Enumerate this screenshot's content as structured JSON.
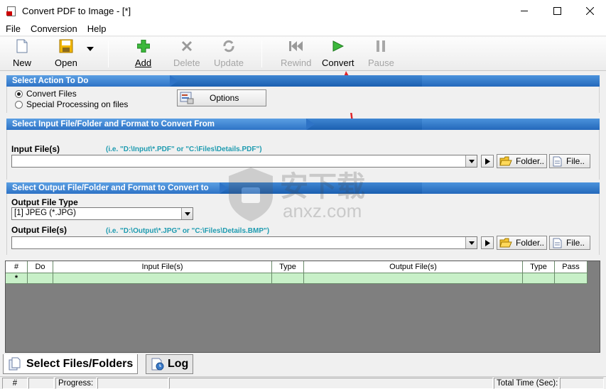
{
  "window": {
    "title": "Convert PDF to Image - [*]"
  },
  "menu": [
    "File",
    "Conversion",
    "Help"
  ],
  "toolbar": {
    "new_label": "New",
    "open_label": "Open",
    "add_label": "Add",
    "delete_label": "Delete",
    "update_label": "Update",
    "rewind_label": "Rewind",
    "convert_label": "Convert",
    "pause_label": "Pause"
  },
  "action_section": {
    "header": "Select Action To Do",
    "radio_convert": "Convert Files",
    "radio_special": "Special Processing on files",
    "options_label": "Options"
  },
  "input_section": {
    "header": "Select Input File/Folder and Format to Convert From",
    "input_label": "Input File(s)",
    "input_hint": "(i.e. \"D:\\Input\\*.PDF\"  or \"C:\\Files\\Details.PDF\")",
    "input_value": "",
    "folder_label": "Folder..",
    "file_label": "File.."
  },
  "output_section": {
    "header": "Select Output File/Folder and Format to Convert to",
    "type_label": "Output File Type",
    "type_value": "[1] JPEG (*.JPG)",
    "output_label": "Output File(s)",
    "output_hint": "(i.e. \"D:\\Output\\*.JPG\"  or \"C:\\Files\\Details.BMP\")",
    "output_value": "",
    "folder_label": "Folder..",
    "file_label": "File.."
  },
  "grid": {
    "columns": [
      "#",
      "Do",
      "Input File(s)",
      "Type",
      "Output File(s)",
      "Type",
      "Pass"
    ],
    "new_row_marker": "*"
  },
  "tabs": {
    "files_label": "Select Files/Folders",
    "log_label": "Log"
  },
  "statusbar": {
    "hash": "#",
    "progress": "Progress:",
    "total_time": "Total Time (Sec):"
  },
  "watermark": {
    "text_cn": "安下载",
    "text_en": "anxz.com"
  }
}
